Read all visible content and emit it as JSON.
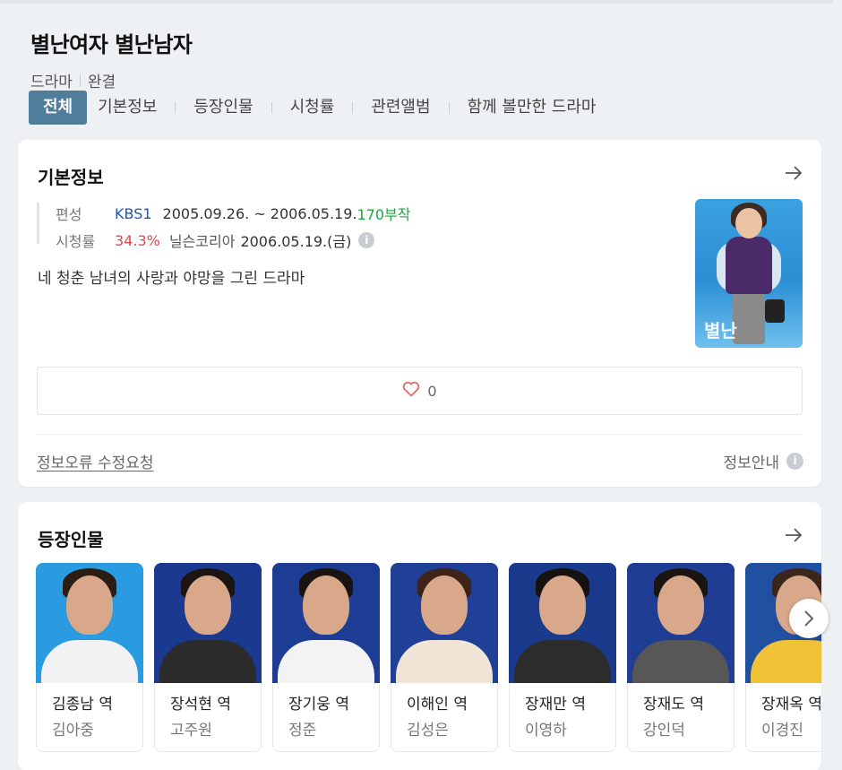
{
  "header": {
    "title": "별난여자 별난남자",
    "genre": "드라마",
    "status": "완결"
  },
  "tabs": [
    {
      "label": "전체",
      "active": true
    },
    {
      "label": "기본정보"
    },
    {
      "label": "등장인물"
    },
    {
      "label": "시청률"
    },
    {
      "label": "관련앨범"
    },
    {
      "label": "함께 볼만한 드라마"
    }
  ],
  "basic_info": {
    "title": "기본정보",
    "broadcast_label": "편성",
    "channel": "KBS1",
    "period": "2005.09.26. ~ 2006.05.19.",
    "episodes": "170부작",
    "rating_label": "시청률",
    "rating": "34.3%",
    "rating_source": "닐슨코리아",
    "rating_date": "2006.05.19.(금)",
    "description": "네 청춘 남녀의 사랑과 야망을 그린 드라마",
    "poster_logo_text": "별난",
    "like_count": "0",
    "correction_link": "정보오류 수정요청",
    "guide_label": "정보안내"
  },
  "cast": {
    "title": "등장인물",
    "items": [
      {
        "role": "김종남 역",
        "actor": "김아중",
        "bg": "#2a9be0",
        "hair": "#2b1c14",
        "top": "#f2f2f2"
      },
      {
        "role": "장석현 역",
        "actor": "고주원",
        "bg": "#1b3a8f",
        "hair": "#1d1512",
        "top": "#2b2b2b"
      },
      {
        "role": "장기웅 역",
        "actor": "정준",
        "bg": "#1d3c94",
        "hair": "#1a1310",
        "top": "#f3f3f3"
      },
      {
        "role": "이해인 역",
        "actor": "김성은",
        "bg": "#203f96",
        "hair": "#3e2418",
        "top": "#efe4d6"
      },
      {
        "role": "장재만 역",
        "actor": "이영하",
        "bg": "#1a3a8c",
        "hair": "#161210",
        "top": "#2c2c2c"
      },
      {
        "role": "장재도 역",
        "actor": "강인덕",
        "bg": "#1f3d92",
        "hair": "#1b1512",
        "top": "#575757"
      },
      {
        "role": "장재옥 역",
        "actor": "이경진",
        "bg": "#2150a0",
        "hair": "#3a261c",
        "top": "#f0c236"
      }
    ]
  },
  "colors": {
    "accent_tab": "#4f7d9a",
    "channel": "#2255aa",
    "episodes": "#21a442",
    "rating": "#e04848"
  },
  "icons": {
    "arrow": "arrow-right-icon",
    "heart": "heart-icon",
    "info": "info-icon",
    "next": "chevron-right-icon"
  }
}
